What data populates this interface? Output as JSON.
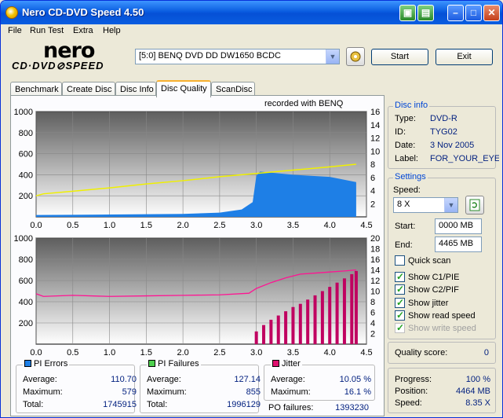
{
  "window": {
    "title": "Nero CD-DVD Speed 4.50"
  },
  "menu": [
    "File",
    "Run Test",
    "Extra",
    "Help"
  ],
  "logo": {
    "brand": "nero",
    "product": "CD·DVD⊘SPEED"
  },
  "drive": {
    "selected": "[5:0]  BENQ DVD DD DW1650 BCDC"
  },
  "buttons": {
    "start": "Start",
    "exit": "Exit"
  },
  "tabs": [
    "Benchmark",
    "Create Disc",
    "Disc Info",
    "Disc Quality",
    "ScanDisc"
  ],
  "active_tab": "Disc Quality",
  "recorded_with": "recorded with BENQ",
  "disc_info": {
    "title": "Disc info",
    "type_label": "Type:",
    "type": "DVD-R",
    "id_label": "ID:",
    "id": "TYG02",
    "date_label": "Date:",
    "date": "3 Nov 2005",
    "label_label": "Label:",
    "label": "FOR_YOUR_EYES"
  },
  "settings": {
    "title": "Settings",
    "speed_label": "Speed:",
    "speed": "8 X",
    "start_label": "Start:",
    "start": "0000 MB",
    "end_label": "End:",
    "end": "4465 MB",
    "quick_scan": "Quick scan",
    "show_c1": "Show C1/PIE",
    "show_c2": "Show C2/PIF",
    "show_jitter": "Show jitter",
    "show_read": "Show read speed",
    "show_write": "Show write speed"
  },
  "quality": {
    "label": "Quality score:",
    "value": "0"
  },
  "progress": {
    "progress_label": "Progress:",
    "progress": "100 %",
    "position_label": "Position:",
    "position": "4464 MB",
    "speed_label": "Speed:",
    "speed": "8.35 X"
  },
  "pi_errors": {
    "title": "PI Errors",
    "average_label": "Average:",
    "average": "110.70",
    "maximum_label": "Maximum:",
    "maximum": "579",
    "total_label": "Total:",
    "total": "1745915"
  },
  "pi_failures": {
    "title": "PI Failures",
    "average_label": "Average:",
    "average": "127.14",
    "maximum_label": "Maximum:",
    "maximum": "855",
    "total_label": "Total:",
    "total": "1996129"
  },
  "jitter": {
    "title": "Jitter",
    "average_label": "Average:",
    "average": "10.05 %",
    "maximum_label": "Maximum:",
    "maximum": "16.1 %",
    "po_label": "PO failures:",
    "po": "1393230"
  },
  "colors": {
    "pi_errors": "#1e7fe6",
    "pi_failures": "#c00060",
    "jitter": "#ff1493",
    "read_speed": "#f0f000"
  },
  "chart_data": [
    {
      "type": "area",
      "name": "PI Errors",
      "x_ticks": [
        "0.0",
        "0.5",
        "1.0",
        "1.5",
        "2.0",
        "2.5",
        "3.0",
        "3.5",
        "4.0",
        "4.5"
      ],
      "y_ticks_left": [
        "200",
        "400",
        "600",
        "800",
        "1000"
      ],
      "y_ticks_right": [
        "2",
        "4",
        "6",
        "8",
        "10",
        "12",
        "14",
        "16"
      ],
      "xlim": [
        0,
        4.5
      ],
      "ylim": [
        0,
        1000
      ],
      "y2lim": [
        0,
        16
      ],
      "series": [
        {
          "x": [
            0,
            0.5,
            1,
            1.5,
            2,
            2.5,
            2.8,
            2.95,
            3.0,
            3.05,
            3.5,
            4.0,
            4.36
          ],
          "values": [
            18,
            20,
            22,
            25,
            28,
            40,
            70,
            140,
            390,
            430,
            400,
            380,
            330
          ]
        },
        {
          "axis": "right",
          "x": [
            0,
            0.1,
            0.5,
            1,
            1.5,
            2,
            2.5,
            3,
            3.5,
            4,
            4.36
          ],
          "values": [
            3.2,
            3.5,
            3.9,
            4.4,
            5.0,
            5.5,
            6.1,
            6.6,
            7.1,
            7.6,
            8.0
          ]
        }
      ]
    },
    {
      "type": "bar",
      "name": "PI Failures / Jitter",
      "x_ticks": [
        "0.0",
        "0.5",
        "1.0",
        "1.5",
        "2.0",
        "2.5",
        "3.0",
        "3.5",
        "4.0",
        "4.5"
      ],
      "y_ticks_left": [
        "200",
        "400",
        "600",
        "800",
        "1000"
      ],
      "y_ticks_right": [
        "2",
        "4",
        "6",
        "8",
        "10",
        "12",
        "14",
        "16",
        "18",
        "20"
      ],
      "xlim": [
        0,
        4.5
      ],
      "ylim": [
        0,
        1000
      ],
      "y2lim": [
        0,
        20
      ],
      "series": [
        {
          "x": [
            3.0,
            3.1,
            3.2,
            3.3,
            3.4,
            3.5,
            3.6,
            3.7,
            3.8,
            3.9,
            4.0,
            4.1,
            4.2,
            4.3,
            4.36
          ],
          "values": [
            120,
            180,
            230,
            270,
            310,
            350,
            380,
            420,
            460,
            500,
            540,
            580,
            620,
            660,
            690
          ]
        },
        {
          "axis": "right",
          "x": [
            0,
            0.1,
            0.5,
            1,
            1.5,
            2,
            2.5,
            2.9,
            3.0,
            3.2,
            3.4,
            3.6,
            3.8,
            4.0,
            4.2,
            4.36
          ],
          "values": [
            9.5,
            9.0,
            9.2,
            9.0,
            9.1,
            9.2,
            9.3,
            9.6,
            10.5,
            11.6,
            12.5,
            13.2,
            13.4,
            13.6,
            13.8,
            14.0
          ]
        }
      ]
    }
  ]
}
